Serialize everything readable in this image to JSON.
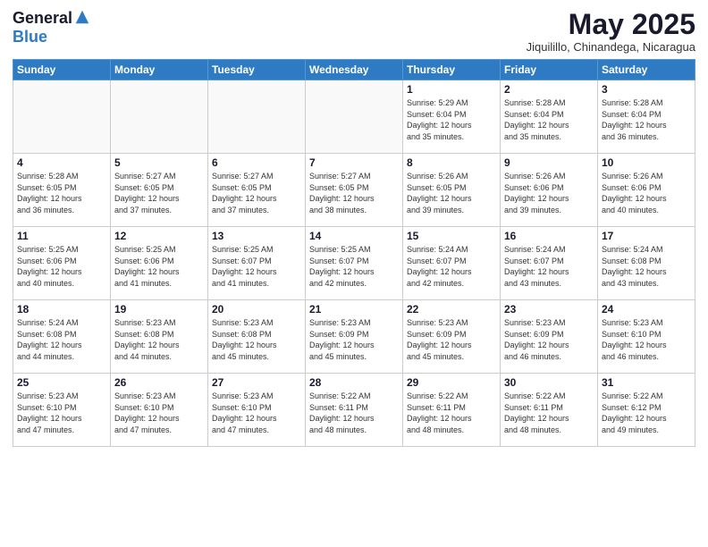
{
  "logo": {
    "general": "General",
    "blue": "Blue"
  },
  "header": {
    "title": "May 2025",
    "subtitle": "Jiquilillo, Chinandega, Nicaragua"
  },
  "weekdays": [
    "Sunday",
    "Monday",
    "Tuesday",
    "Wednesday",
    "Thursday",
    "Friday",
    "Saturday"
  ],
  "weeks": [
    [
      {
        "day": "",
        "info": ""
      },
      {
        "day": "",
        "info": ""
      },
      {
        "day": "",
        "info": ""
      },
      {
        "day": "",
        "info": ""
      },
      {
        "day": "1",
        "info": "Sunrise: 5:29 AM\nSunset: 6:04 PM\nDaylight: 12 hours\nand 35 minutes."
      },
      {
        "day": "2",
        "info": "Sunrise: 5:28 AM\nSunset: 6:04 PM\nDaylight: 12 hours\nand 35 minutes."
      },
      {
        "day": "3",
        "info": "Sunrise: 5:28 AM\nSunset: 6:04 PM\nDaylight: 12 hours\nand 36 minutes."
      }
    ],
    [
      {
        "day": "4",
        "info": "Sunrise: 5:28 AM\nSunset: 6:05 PM\nDaylight: 12 hours\nand 36 minutes."
      },
      {
        "day": "5",
        "info": "Sunrise: 5:27 AM\nSunset: 6:05 PM\nDaylight: 12 hours\nand 37 minutes."
      },
      {
        "day": "6",
        "info": "Sunrise: 5:27 AM\nSunset: 6:05 PM\nDaylight: 12 hours\nand 37 minutes."
      },
      {
        "day": "7",
        "info": "Sunrise: 5:27 AM\nSunset: 6:05 PM\nDaylight: 12 hours\nand 38 minutes."
      },
      {
        "day": "8",
        "info": "Sunrise: 5:26 AM\nSunset: 6:05 PM\nDaylight: 12 hours\nand 39 minutes."
      },
      {
        "day": "9",
        "info": "Sunrise: 5:26 AM\nSunset: 6:06 PM\nDaylight: 12 hours\nand 39 minutes."
      },
      {
        "day": "10",
        "info": "Sunrise: 5:26 AM\nSunset: 6:06 PM\nDaylight: 12 hours\nand 40 minutes."
      }
    ],
    [
      {
        "day": "11",
        "info": "Sunrise: 5:25 AM\nSunset: 6:06 PM\nDaylight: 12 hours\nand 40 minutes."
      },
      {
        "day": "12",
        "info": "Sunrise: 5:25 AM\nSunset: 6:06 PM\nDaylight: 12 hours\nand 41 minutes."
      },
      {
        "day": "13",
        "info": "Sunrise: 5:25 AM\nSunset: 6:07 PM\nDaylight: 12 hours\nand 41 minutes."
      },
      {
        "day": "14",
        "info": "Sunrise: 5:25 AM\nSunset: 6:07 PM\nDaylight: 12 hours\nand 42 minutes."
      },
      {
        "day": "15",
        "info": "Sunrise: 5:24 AM\nSunset: 6:07 PM\nDaylight: 12 hours\nand 42 minutes."
      },
      {
        "day": "16",
        "info": "Sunrise: 5:24 AM\nSunset: 6:07 PM\nDaylight: 12 hours\nand 43 minutes."
      },
      {
        "day": "17",
        "info": "Sunrise: 5:24 AM\nSunset: 6:08 PM\nDaylight: 12 hours\nand 43 minutes."
      }
    ],
    [
      {
        "day": "18",
        "info": "Sunrise: 5:24 AM\nSunset: 6:08 PM\nDaylight: 12 hours\nand 44 minutes."
      },
      {
        "day": "19",
        "info": "Sunrise: 5:23 AM\nSunset: 6:08 PM\nDaylight: 12 hours\nand 44 minutes."
      },
      {
        "day": "20",
        "info": "Sunrise: 5:23 AM\nSunset: 6:08 PM\nDaylight: 12 hours\nand 45 minutes."
      },
      {
        "day": "21",
        "info": "Sunrise: 5:23 AM\nSunset: 6:09 PM\nDaylight: 12 hours\nand 45 minutes."
      },
      {
        "day": "22",
        "info": "Sunrise: 5:23 AM\nSunset: 6:09 PM\nDaylight: 12 hours\nand 45 minutes."
      },
      {
        "day": "23",
        "info": "Sunrise: 5:23 AM\nSunset: 6:09 PM\nDaylight: 12 hours\nand 46 minutes."
      },
      {
        "day": "24",
        "info": "Sunrise: 5:23 AM\nSunset: 6:10 PM\nDaylight: 12 hours\nand 46 minutes."
      }
    ],
    [
      {
        "day": "25",
        "info": "Sunrise: 5:23 AM\nSunset: 6:10 PM\nDaylight: 12 hours\nand 47 minutes."
      },
      {
        "day": "26",
        "info": "Sunrise: 5:23 AM\nSunset: 6:10 PM\nDaylight: 12 hours\nand 47 minutes."
      },
      {
        "day": "27",
        "info": "Sunrise: 5:23 AM\nSunset: 6:10 PM\nDaylight: 12 hours\nand 47 minutes."
      },
      {
        "day": "28",
        "info": "Sunrise: 5:22 AM\nSunset: 6:11 PM\nDaylight: 12 hours\nand 48 minutes."
      },
      {
        "day": "29",
        "info": "Sunrise: 5:22 AM\nSunset: 6:11 PM\nDaylight: 12 hours\nand 48 minutes."
      },
      {
        "day": "30",
        "info": "Sunrise: 5:22 AM\nSunset: 6:11 PM\nDaylight: 12 hours\nand 48 minutes."
      },
      {
        "day": "31",
        "info": "Sunrise: 5:22 AM\nSunset: 6:12 PM\nDaylight: 12 hours\nand 49 minutes."
      }
    ]
  ]
}
